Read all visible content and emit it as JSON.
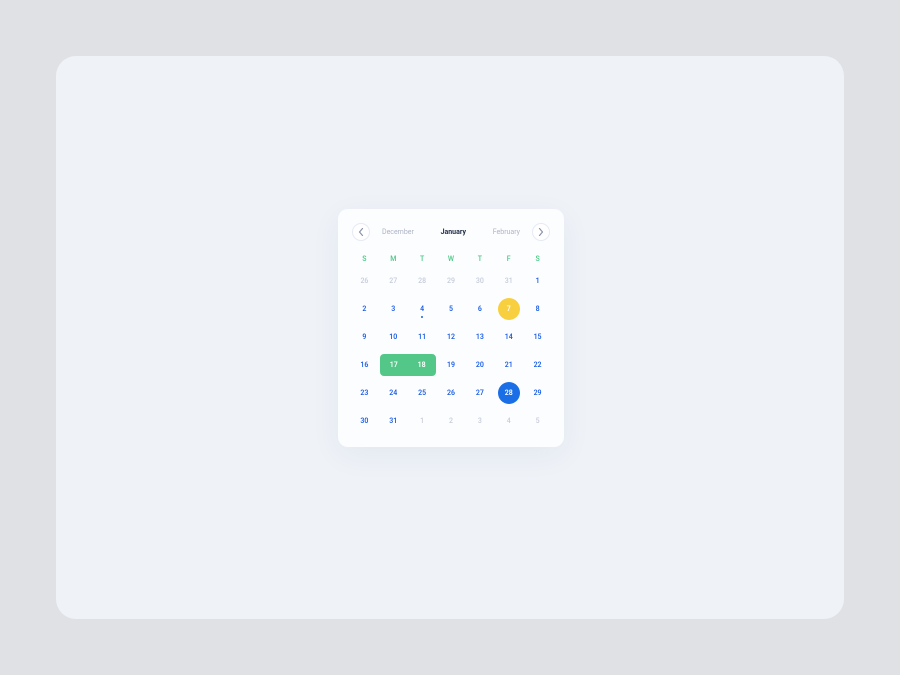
{
  "colors": {
    "page_bg": "#dfe1e5",
    "panel_bg": "#eff3f8",
    "calendar_bg": "#fcfdff",
    "accent_blue": "#1b5ee6",
    "muted": "#c6ccdb",
    "dow_green": "#48c884",
    "range_green": "#53c787",
    "yellow": "#f8cf3e",
    "circle_blue": "#1b6fe6"
  },
  "months": {
    "prev": "December",
    "current": "January",
    "next": "February"
  },
  "weekdays": [
    "S",
    "M",
    "T",
    "W",
    "T",
    "F",
    "S"
  ],
  "days": [
    {
      "n": "26",
      "other": true
    },
    {
      "n": "27",
      "other": true
    },
    {
      "n": "28",
      "other": true
    },
    {
      "n": "29",
      "other": true
    },
    {
      "n": "30",
      "other": true
    },
    {
      "n": "31",
      "other": true
    },
    {
      "n": "1"
    },
    {
      "n": "2"
    },
    {
      "n": "3"
    },
    {
      "n": "4",
      "dot": true
    },
    {
      "n": "5"
    },
    {
      "n": "6"
    },
    {
      "n": "7",
      "style": "yellow"
    },
    {
      "n": "8"
    },
    {
      "n": "9"
    },
    {
      "n": "10"
    },
    {
      "n": "11"
    },
    {
      "n": "12"
    },
    {
      "n": "13"
    },
    {
      "n": "14"
    },
    {
      "n": "15"
    },
    {
      "n": "16"
    },
    {
      "n": "17"
    },
    {
      "n": "18"
    },
    {
      "n": "19"
    },
    {
      "n": "20"
    },
    {
      "n": "21"
    },
    {
      "n": "22"
    },
    {
      "n": "23"
    },
    {
      "n": "24"
    },
    {
      "n": "25"
    },
    {
      "n": "26"
    },
    {
      "n": "27"
    },
    {
      "n": "28",
      "style": "blue"
    },
    {
      "n": "29"
    },
    {
      "n": "30"
    },
    {
      "n": "31"
    },
    {
      "n": "1",
      "other": true
    },
    {
      "n": "2",
      "other": true
    },
    {
      "n": "3",
      "other": true
    },
    {
      "n": "4",
      "other": true
    },
    {
      "n": "5",
      "other": true
    }
  ],
  "range": {
    "start_index": 22,
    "end_index": 23,
    "start_label": "17",
    "end_label": "18"
  }
}
